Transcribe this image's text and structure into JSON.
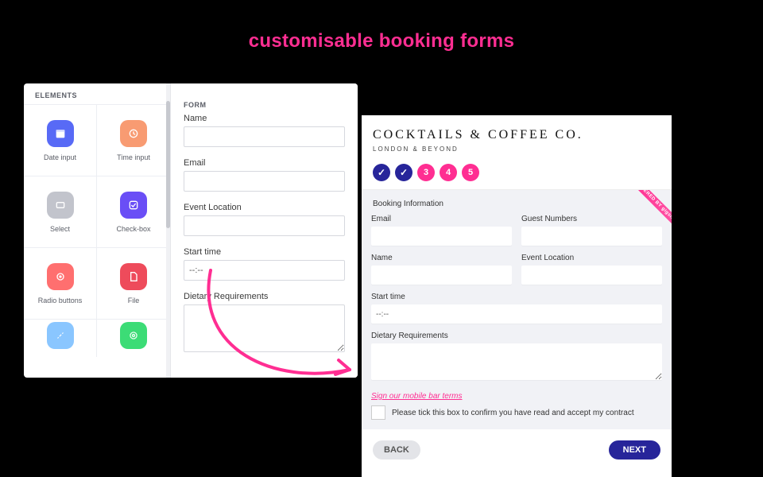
{
  "hero": {
    "title": "customisable booking forms"
  },
  "editor": {
    "elements_header": "ELEMENTS",
    "form_header": "FORM",
    "tiles": [
      {
        "name": "Date input"
      },
      {
        "name": "Time input"
      },
      {
        "name": "Select"
      },
      {
        "name": "Check-box"
      },
      {
        "name": "Radio buttons"
      },
      {
        "name": "File"
      }
    ],
    "form_fields": {
      "name": "Name",
      "email": "Email",
      "event_location": "Event Location",
      "start_time": "Start time",
      "start_time_value": "--:--",
      "dietary": "Dietary Requirements"
    }
  },
  "customer": {
    "brand_title": "COCKTAILS & COFFEE CO.",
    "brand_sub": "LONDON & BEYOND",
    "steps": [
      "done",
      "done",
      "3",
      "4",
      "5"
    ],
    "ribbon": "POWERED BY gigsheet",
    "section_title": "Booking Information",
    "labels": {
      "email": "Email",
      "guests": "Guest Numbers",
      "name": "Name",
      "location": "Event Location",
      "start_time": "Start time",
      "start_time_value": "--:--",
      "dietary": "Dietary Requirements"
    },
    "terms_link": "Sign our mobile bar terms",
    "accept_text": "Please tick this box to confirm you have read and accept my contract",
    "back": "BACK",
    "next": "NEXT"
  }
}
